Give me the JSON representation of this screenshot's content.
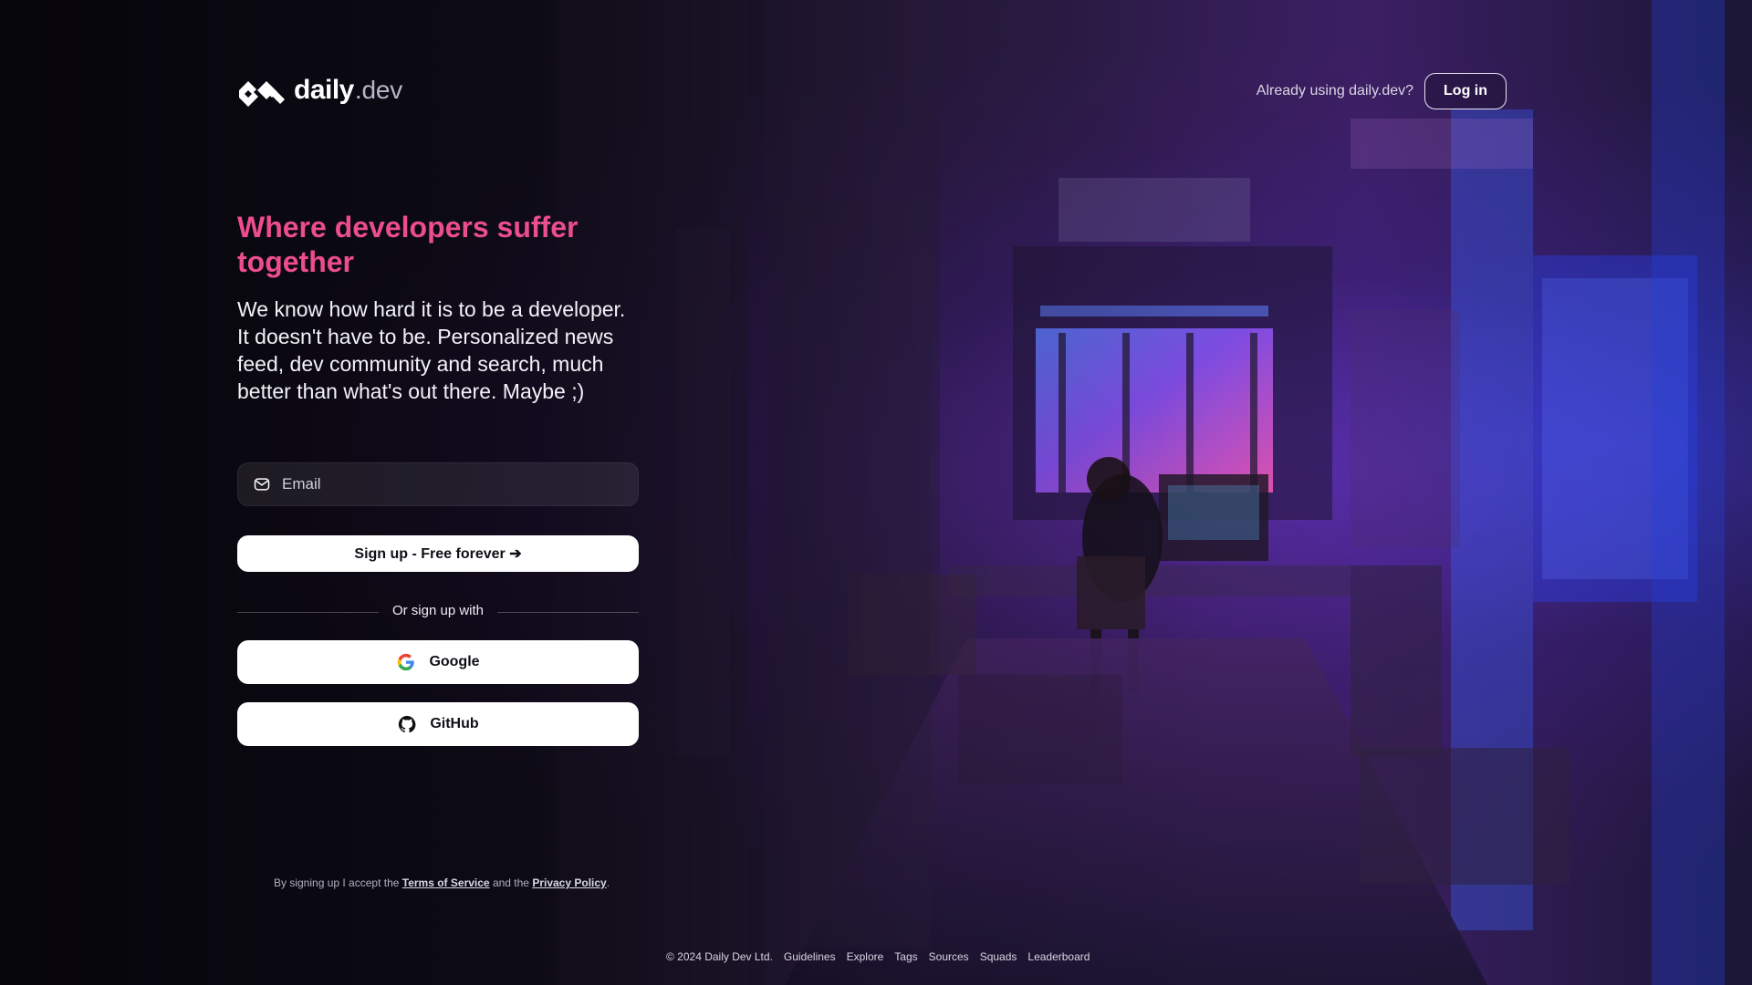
{
  "brand": {
    "name_primary": "daily",
    "name_secondary": ".dev"
  },
  "header": {
    "prompt": "Already using daily.dev?",
    "login_label": "Log in"
  },
  "hero": {
    "title": "Where developers suffer together",
    "description": "We know how hard it is to be a developer. It doesn't have to be. Personalized news feed, dev community and search, much better than what's out there. Maybe ;)"
  },
  "form": {
    "email_placeholder": "Email",
    "email_value": "",
    "signup_label": "Sign up - Free forever ➔",
    "or_label": "Or sign up with",
    "google_label": "Google",
    "github_label": "GitHub"
  },
  "terms": {
    "prefix": "By signing up I accept the",
    "terms_link": "Terms of Service",
    "middle": "and the",
    "privacy_link": "Privacy Policy",
    "suffix": "."
  },
  "footer": {
    "copyright": "© 2024 Daily Dev Ltd.",
    "links": [
      "Guidelines",
      "Explore",
      "Tags",
      "Sources",
      "Squads",
      "Leaderboard"
    ]
  },
  "colors": {
    "accent_pink": "#ec4d8c",
    "button_bg": "#ffffff",
    "text_light": "#f3f1f8",
    "text_muted": "#b3b0c3"
  },
  "icons": {
    "logo": "daily-dev-logo-icon",
    "email": "mail-icon",
    "google": "google-icon",
    "github": "github-icon"
  }
}
